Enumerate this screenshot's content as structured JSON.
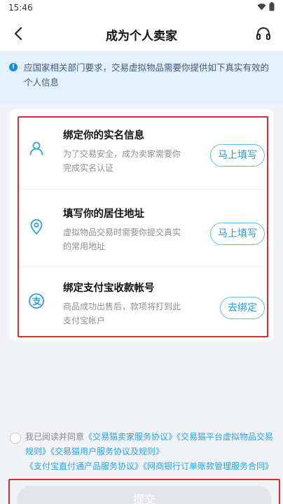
{
  "status_bar": {
    "time": "15:46"
  },
  "header": {
    "title": "成为个人卖家"
  },
  "notice": {
    "text": "应国家相关部门要求，交易虚拟物品需要你提供如下真实有效的个人信息"
  },
  "tasks": [
    {
      "title": "绑定你的实名信息",
      "desc": "为了交易安全，成为卖家需要你完成实名认证",
      "button": "马上填写",
      "icon": "person-icon"
    },
    {
      "title": "填写你的居住地址",
      "desc": "虚拟物品交易时需要你提交真实的常用地址",
      "button": "马上填写",
      "icon": "location-pin-icon"
    },
    {
      "title": "绑定支付宝收款帐号",
      "desc": "商品成功出售后，款项将打到此支付宝帐户",
      "button": "去绑定",
      "icon": "alipay-icon"
    }
  ],
  "agreement": {
    "prefix": "我已阅读并同意",
    "links": [
      "《交易猫卖家服务协议》",
      "《交易猫平台虚拟物品交易规则》",
      "《交易猫用户服务协议及规则》",
      "《支付宝直付通产品服务协议》",
      "《网商银行订单账款管理服务合同》"
    ]
  },
  "submit": {
    "label": "提交"
  },
  "colors": {
    "accent": "#1a9be0",
    "highlight": "#e0282e",
    "notice_bg": "#e3f1fd"
  }
}
